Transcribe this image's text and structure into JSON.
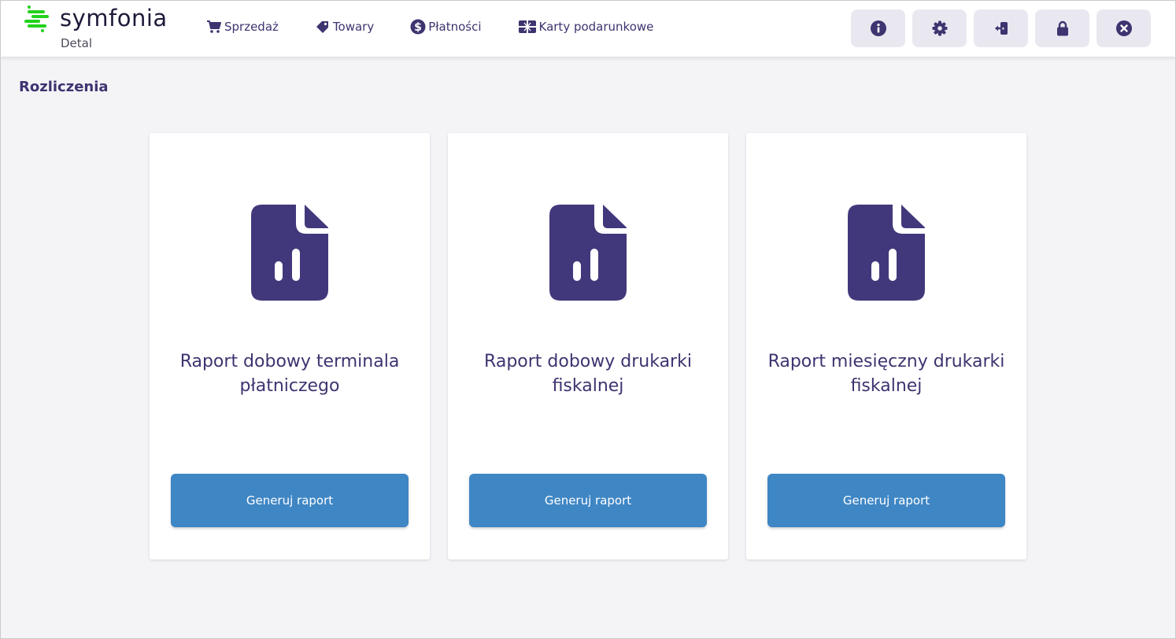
{
  "brand": {
    "name": "symfonia",
    "subtitle": "Detal",
    "logo_color": "#23d21c"
  },
  "nav": [
    {
      "label": "Sprzedaż",
      "icon": "cart-icon"
    },
    {
      "label": "Towary",
      "icon": "tag-icon"
    },
    {
      "label": "Płatności",
      "icon": "dollar-icon"
    },
    {
      "label": "Karty podarunkowe",
      "icon": "gift-card-icon"
    }
  ],
  "toolbar": [
    {
      "icon": "info-icon"
    },
    {
      "icon": "gear-icon"
    },
    {
      "icon": "logout-icon"
    },
    {
      "icon": "lock-icon"
    },
    {
      "icon": "close-icon"
    }
  ],
  "page": {
    "title": "Rozliczenia"
  },
  "cards": [
    {
      "title_line1": "Raport dobowy terminala",
      "title_line2": "płatniczego",
      "button": "Generuj raport",
      "icon": "report-file-icon"
    },
    {
      "title_line1": "Raport dobowy drukarki",
      "title_line2": "fiskalnej",
      "button": "Generuj raport",
      "icon": "report-file-icon"
    },
    {
      "title_line1": "Raport miesięczny drukarki",
      "title_line2": "fiskalnej",
      "button": "Generuj raport",
      "icon": "report-file-icon"
    }
  ],
  "colors": {
    "primary": "#3d3470",
    "button": "#3f86c4",
    "background": "#f4f4f7"
  }
}
